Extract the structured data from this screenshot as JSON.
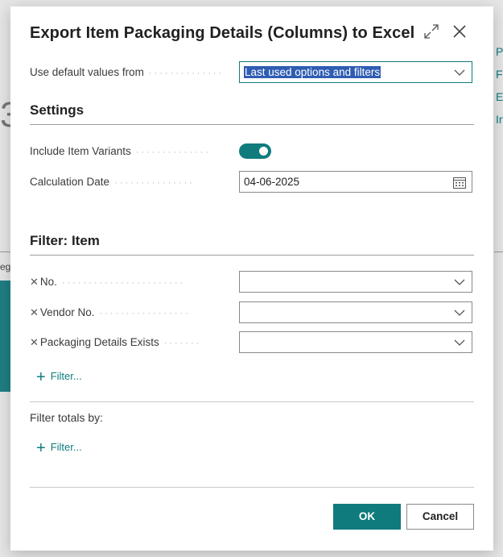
{
  "background": {
    "links": [
      "P",
      "Fi",
      "Es",
      "In"
    ],
    "big_char": "3",
    "side_label": "eg"
  },
  "dialog": {
    "title": "Export Item Packaging Details (Columns) to Excel",
    "use_default": {
      "label": "Use default values from",
      "value": "Last used options and filters"
    },
    "settings": {
      "title": "Settings",
      "include_variants_label": "Include Item Variants",
      "include_variants_on": true,
      "calc_date_label": "Calculation Date",
      "calc_date_value": "04-06-2025"
    },
    "filter_item": {
      "title": "Filter: Item",
      "rows": [
        {
          "label": "No.",
          "value": ""
        },
        {
          "label": "Vendor No.",
          "value": ""
        },
        {
          "label": "Packaging Details Exists",
          "value": ""
        }
      ],
      "add_filter_label": "Filter..."
    },
    "filter_totals": {
      "label": "Filter totals by:",
      "add_filter_label": "Filter..."
    },
    "buttons": {
      "ok": "OK",
      "cancel": "Cancel"
    }
  },
  "colors": {
    "accent": "#0f7b7d",
    "selection": "#2f5db3"
  }
}
